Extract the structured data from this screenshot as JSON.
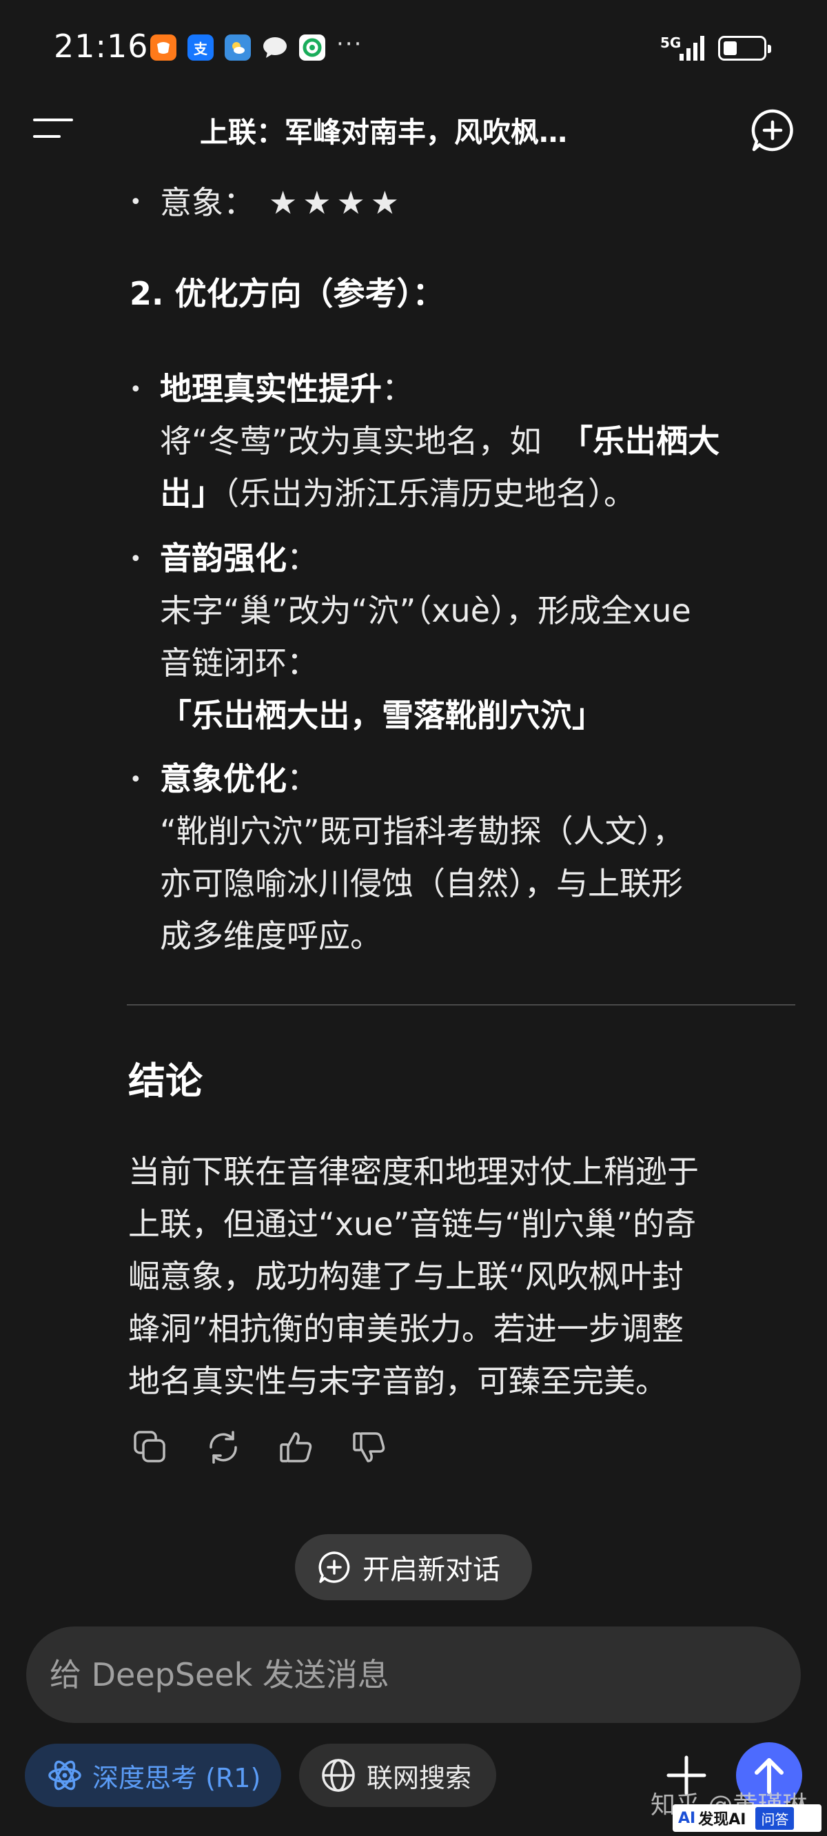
{
  "status_bar": {
    "time": "21:16",
    "network": "5G",
    "battery_level": 0.35,
    "more": "···",
    "app_icons": [
      "taobao-icon",
      "alipay-icon",
      "weather-icon",
      "message-icon",
      "green-app-icon"
    ]
  },
  "header": {
    "title": "上联：军峰对南丰，风吹枫…"
  },
  "content": {
    "imagery_label": "意象：",
    "imagery_stars": "★★★★",
    "rating": 4,
    "opt_heading": "2. 优化方向（参考）：",
    "items": [
      {
        "title": "地理真实性提升",
        "colon": "：",
        "line1_pre": "将“冬莺”改为真实地名，如",
        "line1_bold": "「乐岀栖大",
        "line2_bold": "岀」",
        "line2_post": "（乐岀为浙江乐清历史地名）。"
      },
      {
        "title": "音韵强化",
        "colon": "：",
        "line1": "末字“巢”改为“泬”（xuè），形成全xue",
        "line2": "音链闭环：",
        "line3_bold": "「乐岀栖大岀，雪落靴削穴泬」"
      },
      {
        "title": "意象优化",
        "colon": "：",
        "line1": "“靴削穴泬”既可指科考勘探（人文），",
        "line2": "亦可隐喻冰川侵蚀（自然），与上联形",
        "line3": "成多维度呼应。"
      }
    ],
    "conclusion_title": "结论",
    "conclusion_lines": [
      "当前下联在音律密度和地理对仗上稍逊于",
      "上联，但通过“xue”音链与“削穴巢”的奇",
      "崛意象，成功构建了与上联“风吹枫叶封",
      "蜂洞”相抗衡的审美张力。若进一步调整",
      "地名真实性与末字音韵，可臻至完美。"
    ]
  },
  "actions": {
    "new_dialog_label": "开启新对话"
  },
  "composer": {
    "placeholder": "给 DeepSeek 发送消息",
    "deepthink_label": "深度思考 (R1)",
    "websearch_label": "联网搜索"
  },
  "watermark": {
    "text": "知乎 @黄瑾琳",
    "badge_ai": "AI",
    "badge_brand": "发现AI",
    "badge_qa": "问答"
  },
  "colors": {
    "background": "#181818",
    "accent_blue": "#4d6bfe",
    "deepthink_bg": "#1e3250",
    "deepthink_text": "#5b9cf6"
  }
}
